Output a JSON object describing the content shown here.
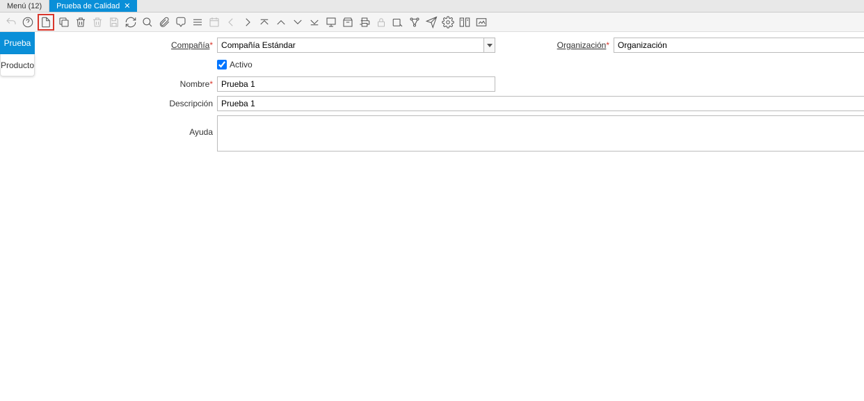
{
  "tabs": {
    "menu": "Menú (12)",
    "active": "Prueba de Calidad",
    "close_sym": "✕"
  },
  "sideTabs": {
    "t0": "Prueba",
    "t1": "Producto"
  },
  "form": {
    "compania_label": "Compañía",
    "compania_value": "Compañía Estándar",
    "org_label": "Organización",
    "org_value": "Organización",
    "activo_label": "Activo",
    "nombre_label": "Nombre",
    "nombre_value": "Prueba 1",
    "desc_label": "Descripción",
    "desc_value": "Prueba 1",
    "ayuda_label": "Ayuda",
    "ayuda_value": ""
  }
}
